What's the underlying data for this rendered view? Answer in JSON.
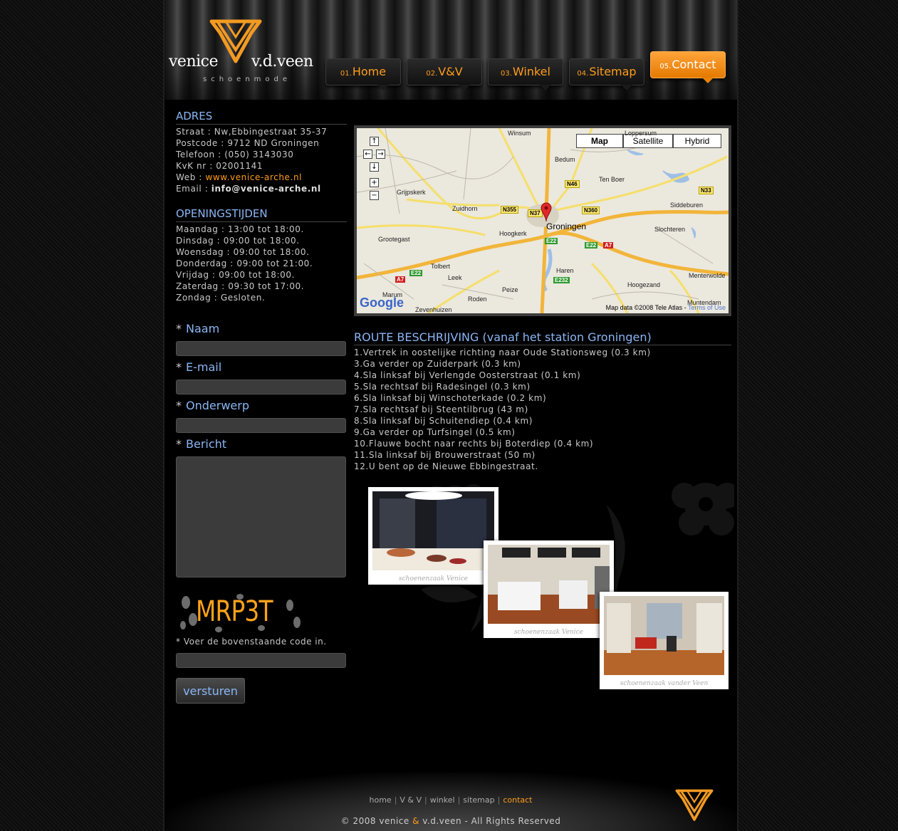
{
  "brand": {
    "name_left": "venice",
    "name_right": "v.d.veen",
    "tagline": "schoenmode",
    "accent": "#ff9c1a",
    "link_blue": "#8ab6f5"
  },
  "nav": [
    {
      "num": "01.",
      "label": "Home"
    },
    {
      "num": "02.",
      "label": "V&V"
    },
    {
      "num": "03.",
      "label": "Winkel"
    },
    {
      "num": "04.",
      "label": "Sitemap"
    },
    {
      "num": "05.",
      "label": "Contact",
      "active": true
    }
  ],
  "address": {
    "title": "ADRES",
    "lines": [
      {
        "label": "Straat : ",
        "value": "Nw,Ebbingestraat 35-37"
      },
      {
        "label": "Postcode : ",
        "value": "9712 ND Groningen"
      },
      {
        "label": "Telefoon : ",
        "value": "(050) 3143030"
      },
      {
        "label": "KvK nr : ",
        "value": "02001141"
      },
      {
        "label": "Web : ",
        "value": "www.venice-arche.nl"
      },
      {
        "label": "Email : ",
        "value": "info@venice-arche.nl"
      }
    ]
  },
  "hours": {
    "title": "OPENINGSTIJDEN",
    "lines": [
      "Maandag : 13:00 tot 18:00.",
      "Dinsdag : 09:00 tot 18:00.",
      "Woensdag : 09:00 tot 18:00.",
      "Donderdag : 09:00 tot 21:00.",
      "Vrijdag : 09:00 tot 18:00.",
      "Zaterdag : 09:30 tot 17:00.",
      "Zondag : Gesloten."
    ]
  },
  "form": {
    "required_mark": "*",
    "naam": "Naam",
    "email": "E-mail",
    "onderwerp": "Onderwerp",
    "bericht": "Bericht",
    "captcha_code": "MRP3T",
    "captcha_note": "Voer de bovenstaande code in.",
    "submit": "versturen"
  },
  "map": {
    "types": [
      "Map",
      "Satellite",
      "Hybrid"
    ],
    "selected": "Map",
    "places": {
      "winsum": "Winsum",
      "loppersum": "Loppersum",
      "bedum": "Bedum",
      "tenboer": "Ten Boer",
      "grijpskerk": "Grijpskerk",
      "zuidhorn": "Zuidhorn",
      "groningen": "Groningen",
      "siddeburen": "Siddeburen",
      "grootegast": "Grootegast",
      "hoogkerk": "Hoogkerk",
      "slochteren": "Slochteren",
      "tolbert": "Tolbert",
      "leek": "Leek",
      "haren": "Haren",
      "menterwolde": "Menterwolde",
      "hoogezand": "Hoogezand",
      "marum": "Marum",
      "roden": "Roden",
      "peize": "Peize",
      "muntendam": "Muntendam",
      "zevenhuizen": "Zevenhuizen"
    },
    "shields": {
      "n46": "N46",
      "n33": "N33",
      "n355": "N355",
      "n37": "N37",
      "n360": "N360",
      "e22a": "E22",
      "e22b": "E22",
      "a7a": "A7",
      "e22c": "E22",
      "a7b": "A7",
      "e232": "E232"
    },
    "logo": "Google",
    "attribution": "Map data ©2008 Tele Atlas - ",
    "terms": "Terms of Use"
  },
  "route": {
    "title": "ROUTE BESCHRIJVING (vanaf het station Groningen)",
    "steps": [
      "1.Vertrek in oostelijke richting naar Oude Stationsweg (0.3 km)",
      "3.Ga verder op Zuiderpark (0.3 km)",
      "4.Sla linksaf bij Verlengde Oosterstraat (0.1 km)",
      "5.Sla rechtsaf bij Radesingel (0.3 km)",
      "6.Sla linksaf bij Winschoterkade (0.2 km)",
      "7.Sla rechtsaf bij Steentilbrug (43 m)",
      "8.Sla linksaf bij Schuitendiep (0.4 km)",
      "9.Ga verder op Turfsingel (0.5 km)",
      "10.Flauwe bocht naar rechts bij Boterdiep (0.4 km)",
      "11.Sla linksaf bij Brouwerstraat (50 m)",
      "12.U bent op de Nieuwe Ebbingestraat."
    ]
  },
  "photos": [
    {
      "caption": "schoenenzaak Venice"
    },
    {
      "caption": "schoenenzaak Venice"
    },
    {
      "caption": "schoenenzaak vander Veen"
    }
  ],
  "footer": {
    "links": [
      "home",
      "V & V",
      "winkel",
      "sitemap",
      "contact"
    ],
    "sep": "|",
    "copy_pre": "© 2008 venice ",
    "copy_amp": "&",
    "copy_post": " v.d.veen - All Rights Reserved"
  }
}
